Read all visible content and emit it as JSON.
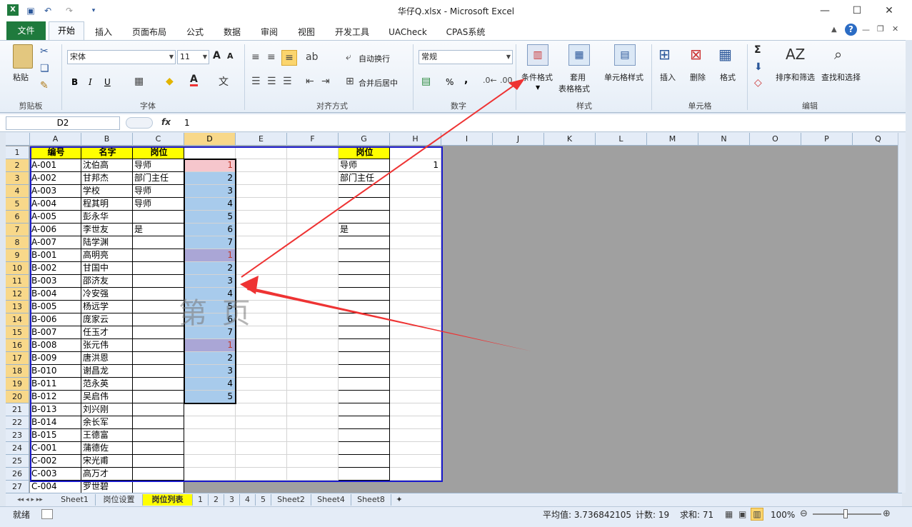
{
  "title": "华仔Q.xlsx  -  Microsoft Excel",
  "window": {
    "minimize": "—",
    "maximize": "☐",
    "close": "✕"
  },
  "tabs": [
    "开始",
    "插入",
    "页面布局",
    "公式",
    "数据",
    "审阅",
    "视图",
    "开发工具",
    "UACheck",
    "CPAS系统"
  ],
  "file_tab": "文件",
  "ribbon": {
    "clipboard": {
      "paste": "粘贴",
      "label": "剪贴板"
    },
    "font": {
      "name": "宋体",
      "size": "11",
      "bold": "B",
      "italic": "I",
      "underline": "U",
      "label": "字体"
    },
    "align": {
      "wrap": "自动换行",
      "merge": "合并后居中",
      "label": "对齐方式"
    },
    "number": {
      "format": "常规",
      "percent": "%",
      "comma": ",",
      "label": "数字"
    },
    "styles": {
      "cond": "条件格式",
      "table1": "套用",
      "table2": "表格格式",
      "cell": "单元格样式",
      "label": "样式"
    },
    "cells": {
      "insert": "插入",
      "delete": "删除",
      "format": "格式",
      "label": "单元格"
    },
    "edit": {
      "sort": "排序和筛选",
      "find": "查找和选择",
      "label": "编辑"
    }
  },
  "formula": {
    "namebox": "D2",
    "fx": "fx",
    "value": "1"
  },
  "columns": [
    "A",
    "B",
    "C",
    "D",
    "E",
    "F",
    "G",
    "H",
    "I",
    "J",
    "K",
    "L",
    "M",
    "N",
    "O",
    "P",
    "Q"
  ],
  "rows": [
    {
      "n": "1",
      "a": "编号",
      "b": "名字",
      "c": "岗位",
      "d": "",
      "g": "岗位",
      "h": ""
    },
    {
      "n": "2",
      "a": "A-001",
      "b": "沈伯高",
      "c": "导师",
      "d": "1",
      "g": "导师",
      "h": "1"
    },
    {
      "n": "3",
      "a": "A-002",
      "b": "甘邦杰",
      "c": "部门主任",
      "d": "2",
      "g": "部门主任",
      "h": ""
    },
    {
      "n": "4",
      "a": "A-003",
      "b": "学校",
      "c": "导师",
      "d": "3",
      "g": "",
      "h": ""
    },
    {
      "n": "5",
      "a": "A-004",
      "b": "程其明",
      "c": "导师",
      "d": "4",
      "g": "",
      "h": ""
    },
    {
      "n": "6",
      "a": "A-005",
      "b": "彭永华",
      "c": "",
      "d": "5",
      "g": "",
      "h": ""
    },
    {
      "n": "7",
      "a": "A-006",
      "b": "李世友",
      "c": "是",
      "d": "6",
      "g": "是",
      "h": ""
    },
    {
      "n": "8",
      "a": "A-007",
      "b": "陆学渊",
      "c": "",
      "d": "7",
      "g": "",
      "h": ""
    },
    {
      "n": "9",
      "a": "B-001",
      "b": "高明亮",
      "c": "",
      "d": "1",
      "g": "",
      "h": ""
    },
    {
      "n": "10",
      "a": "B-002",
      "b": "甘国中",
      "c": "",
      "d": "2",
      "g": "",
      "h": ""
    },
    {
      "n": "11",
      "a": "B-003",
      "b": "邵济友",
      "c": "",
      "d": "3",
      "g": "",
      "h": ""
    },
    {
      "n": "12",
      "a": "B-004",
      "b": "冷安强",
      "c": "",
      "d": "4",
      "g": "",
      "h": ""
    },
    {
      "n": "13",
      "a": "B-005",
      "b": "杨远学",
      "c": "",
      "d": "5",
      "g": "",
      "h": ""
    },
    {
      "n": "14",
      "a": "B-006",
      "b": "庞家云",
      "c": "",
      "d": "6",
      "g": "",
      "h": ""
    },
    {
      "n": "15",
      "a": "B-007",
      "b": "任玉才",
      "c": "",
      "d": "7",
      "g": "",
      "h": ""
    },
    {
      "n": "16",
      "a": "B-008",
      "b": "张元伟",
      "c": "",
      "d": "1",
      "g": "",
      "h": ""
    },
    {
      "n": "17",
      "a": "B-009",
      "b": "唐洪恩",
      "c": "",
      "d": "2",
      "g": "",
      "h": ""
    },
    {
      "n": "18",
      "a": "B-010",
      "b": "谢昌龙",
      "c": "",
      "d": "3",
      "g": "",
      "h": ""
    },
    {
      "n": "19",
      "a": "B-011",
      "b": "范永英",
      "c": "",
      "d": "4",
      "g": "",
      "h": ""
    },
    {
      "n": "20",
      "a": "B-012",
      "b": "吴启伟",
      "c": "",
      "d": "5",
      "g": "",
      "h": ""
    },
    {
      "n": "21",
      "a": "B-013",
      "b": "刘兴刚",
      "c": "",
      "d": "",
      "g": "",
      "h": ""
    },
    {
      "n": "22",
      "a": "B-014",
      "b": "余长军",
      "c": "",
      "d": "",
      "g": "",
      "h": ""
    },
    {
      "n": "23",
      "a": "B-015",
      "b": "王德富",
      "c": "",
      "d": "",
      "g": "",
      "h": ""
    },
    {
      "n": "24",
      "a": "C-001",
      "b": "蒲德佐",
      "c": "",
      "d": "",
      "g": "",
      "h": ""
    },
    {
      "n": "25",
      "a": "C-002",
      "b": "宋光甫",
      "c": "",
      "d": "",
      "g": "",
      "h": ""
    },
    {
      "n": "26",
      "a": "C-003",
      "b": "高万才",
      "c": "",
      "d": "",
      "g": "",
      "h": ""
    },
    {
      "n": "27",
      "a": "C-004",
      "b": "罗世碧",
      "c": "",
      "d": "",
      "g": "",
      "h": ""
    }
  ],
  "watermark": "第  页",
  "sheets": [
    "Sheet1",
    "岗位设置",
    "岗位列表",
    "1",
    "2",
    "3",
    "4",
    "5",
    "Sheet2",
    "Sheet4",
    "Sheet8"
  ],
  "status": {
    "ready": "就绪",
    "avg": "平均值: 3.736842105",
    "count": "计数: 19",
    "sum": "求和: 71",
    "zoom": "100%"
  },
  "colors": {
    "header_yellow": "#ffff00",
    "selection_blue": "#a8cbec",
    "pink": "#f6c6cc",
    "purple": "#aaa6d6",
    "arrow_red": "#ee3333"
  }
}
